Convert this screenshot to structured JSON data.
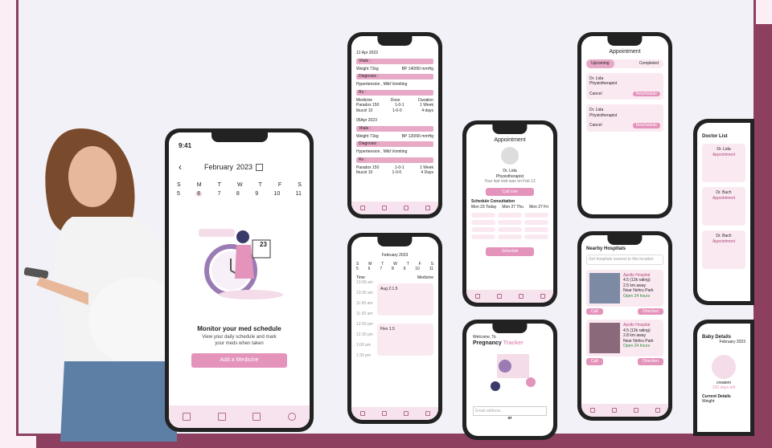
{
  "main": {
    "time": "9:41",
    "month": "February",
    "year": "2023",
    "weekdays": [
      "S",
      "M",
      "T",
      "W",
      "T",
      "F",
      "S"
    ],
    "days": [
      "5",
      "6",
      "7",
      "8",
      "9",
      "10",
      "11"
    ],
    "cal_num": "23",
    "title": "Monitor your med schedule",
    "subtitle1": "View your daily schedule and mark",
    "subtitle2": "your meds when taken",
    "cta": "Add a Medicine"
  },
  "history": {
    "date1": "12 Apr 2023",
    "vitals": "Vitals :",
    "weight": "Weight 71kg",
    "bp1": "BP 140/90 mmHg",
    "diagnosis": "Diagnosis :",
    "diag_text": "Hypertension , Mild Vomiting",
    "rx": "Rx :",
    "cols": [
      "Medicine",
      "Dose",
      "Duration"
    ],
    "rows1": [
      [
        "Paradox 150",
        "1-0-1",
        "1 Week"
      ],
      [
        "Ibucol 10",
        "1-0-0",
        "4 days"
      ]
    ],
    "date2": "05Apr 2023",
    "bp2": "BP 120/90 mmHg",
    "rows2": [
      [
        "Paradox 150",
        "1-0-1",
        "1 Week"
      ],
      [
        "Ibucol 10",
        "1-0-0",
        "4 Days"
      ]
    ]
  },
  "appointment": {
    "title": "Appointment",
    "doctor": "Dr. Lida",
    "role": "Physiotherapist",
    "last_visit": "Your last visit was on Feb 12",
    "cta": "Call now",
    "schedule": "Schedule Consultation",
    "days": [
      "Mon 23 Today",
      "Mon 27 Thu",
      "Mon 27 Fri"
    ],
    "book": "Schedule"
  },
  "medsched": {
    "month": "February",
    "year": "2023",
    "time_col": "Time",
    "med_col": "Medicine",
    "times": [
      "10:00 am",
      "10:30 am",
      "11:00 am",
      "11:30 am",
      "12:00 pm",
      "12:30 pm",
      "1:00 pm",
      "1:30 pm"
    ],
    "med1": "Aug 2:1.5",
    "med2": "Flex 1.5"
  },
  "welcome": {
    "line1": "Welcome, To",
    "line2": "Pregnancy",
    "line3": "Tracker",
    "email": "Email address",
    "or": "or"
  },
  "appts": {
    "title": "Appointment",
    "tabs": [
      "Upcoming",
      "Completed"
    ],
    "doctor": "Dr. Lida",
    "role": "Physiotherapist",
    "cancel": "Cancel",
    "reschedule": "Reschedule"
  },
  "hospitals": {
    "title": "Nearby Hospitals",
    "search": "Get hospitals nearest to this location",
    "h1": "Apollo Hospital",
    "rating1": "4.5 (13k rating)",
    "dist1": "2.5 km away",
    "near": "Near Nehru Park",
    "open": "Open 24 hours",
    "call": "Call",
    "direction": "Direction",
    "h2": "Apollo Hospital",
    "rating2": "4.5 (13k rating)",
    "dist2": "2.8 km away"
  },
  "doctors": {
    "title": "Doctor List",
    "names": [
      "Dr. Lida",
      "Dr. Bach",
      "Dr. Bach"
    ],
    "btn": "Appointment"
  },
  "baby": {
    "title": "Baby Details",
    "month": "February 2023",
    "created": "createm",
    "days": "200 days left",
    "current": "Current Details",
    "weight": "Weight"
  },
  "colors": {
    "accent": "#e493bb",
    "frame": "#8c3f5f"
  }
}
